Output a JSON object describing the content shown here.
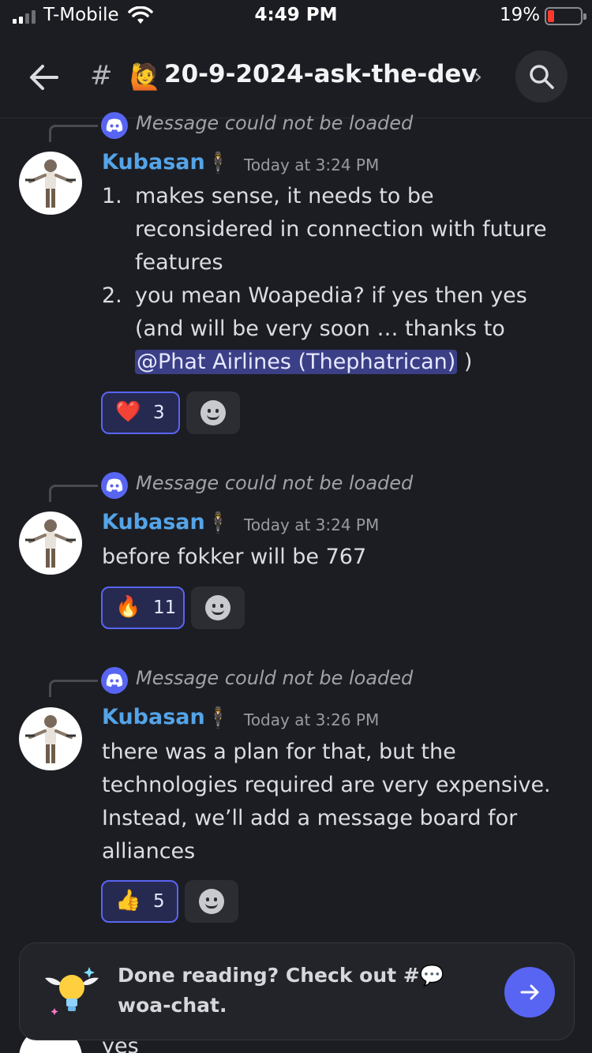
{
  "status_bar": {
    "carrier": "T-Mobile",
    "time": "4:49 PM",
    "battery_percent": "19%",
    "battery_level": 0.19
  },
  "header": {
    "hash": "#",
    "channel_emoji": "🙋",
    "channel_name": "20-9-2024-ask-the-dev",
    "chevron": "›"
  },
  "messages": [
    {
      "reply_text": "Message could not be loaded",
      "author": "Kubasan",
      "badge": "🕴",
      "timestamp": "Today at 3:24 PM",
      "list": [
        {
          "num": "1.",
          "text": "makes sense, it needs to be reconsidered in connection with future features"
        },
        {
          "num": "2.",
          "text_before": "you mean Woapedia? if yes then yes (and will be very soon … thanks to ",
          "mention": "@Phat Airlines (Thephatrican)",
          "text_after": " )"
        }
      ],
      "reaction": {
        "emoji": "❤️",
        "count": "3"
      }
    },
    {
      "reply_text": "Message could not be loaded",
      "author": "Kubasan",
      "badge": "🕴",
      "timestamp": "Today at 3:24 PM",
      "text": "before fokker will be 767",
      "reaction": {
        "emoji": "🔥",
        "count": "11"
      }
    },
    {
      "reply_text": "Message could not be loaded",
      "author": "Kubasan",
      "badge": "🕴",
      "timestamp": "Today at 3:26 PM",
      "text": "there was a plan for that, but the technologies required are very expensive. Instead, we’ll add a message board for alliances",
      "reaction": {
        "emoji": "👍",
        "count": "5"
      }
    }
  ],
  "banner": {
    "text": "Done reading? Check out #💬woa-chat."
  },
  "peek_text": "yes",
  "colors": {
    "background": "#1c1d22",
    "accent": "#5865f2",
    "username": "#54a4e8",
    "mention_bg": "#3b3f86"
  }
}
